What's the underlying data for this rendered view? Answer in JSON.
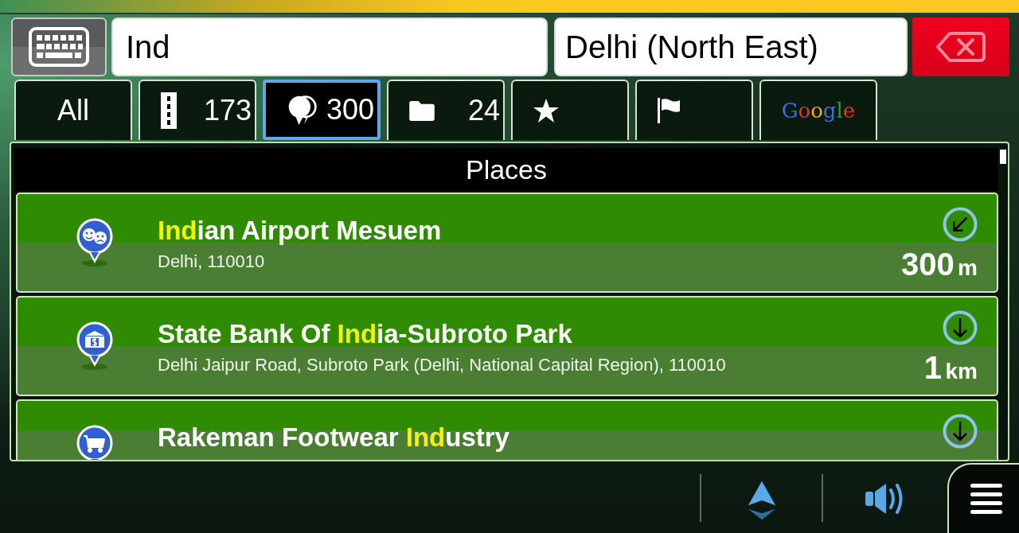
{
  "search": {
    "value": "Ind"
  },
  "location": {
    "value": "Delhi (North East)"
  },
  "tabs": [
    {
      "kind": "all",
      "label": "All",
      "selected": false
    },
    {
      "kind": "roads",
      "count": "173",
      "selected": false
    },
    {
      "kind": "places",
      "count": "300",
      "selected": true
    },
    {
      "kind": "folder",
      "count": "24",
      "selected": false
    },
    {
      "kind": "favorites",
      "selected": false
    },
    {
      "kind": "flag",
      "selected": false
    },
    {
      "kind": "google",
      "label": "Google",
      "selected": false
    }
  ],
  "list": {
    "title": "Places",
    "rows": [
      {
        "kind": "theatre",
        "title": [
          {
            "text": "Ind",
            "highlight": true
          },
          {
            "text": "ian Airport Mesuem",
            "highlight": false
          }
        ],
        "address": "Delhi, 110010",
        "arrow": {
          "kind": "southwest"
        },
        "distance": {
          "value": "300",
          "unit": "m"
        }
      },
      {
        "kind": "bank",
        "title": [
          {
            "text": "State Bank Of ",
            "highlight": false
          },
          {
            "text": "Ind",
            "highlight": true
          },
          {
            "text": "ia-Subroto Park",
            "highlight": false
          }
        ],
        "address": "Delhi Jaipur Road, Subroto Park (Delhi, National Capital Region), 110010",
        "arrow": {
          "kind": "south"
        },
        "distance": {
          "value": "1",
          "unit": "km"
        }
      },
      {
        "kind": "shopping",
        "title": [
          {
            "text": "Rakeman Footwear ",
            "highlight": false
          },
          {
            "text": "Ind",
            "highlight": true
          },
          {
            "text": "ustry",
            "highlight": false
          }
        ],
        "arrow": {
          "kind": "south"
        }
      }
    ]
  }
}
